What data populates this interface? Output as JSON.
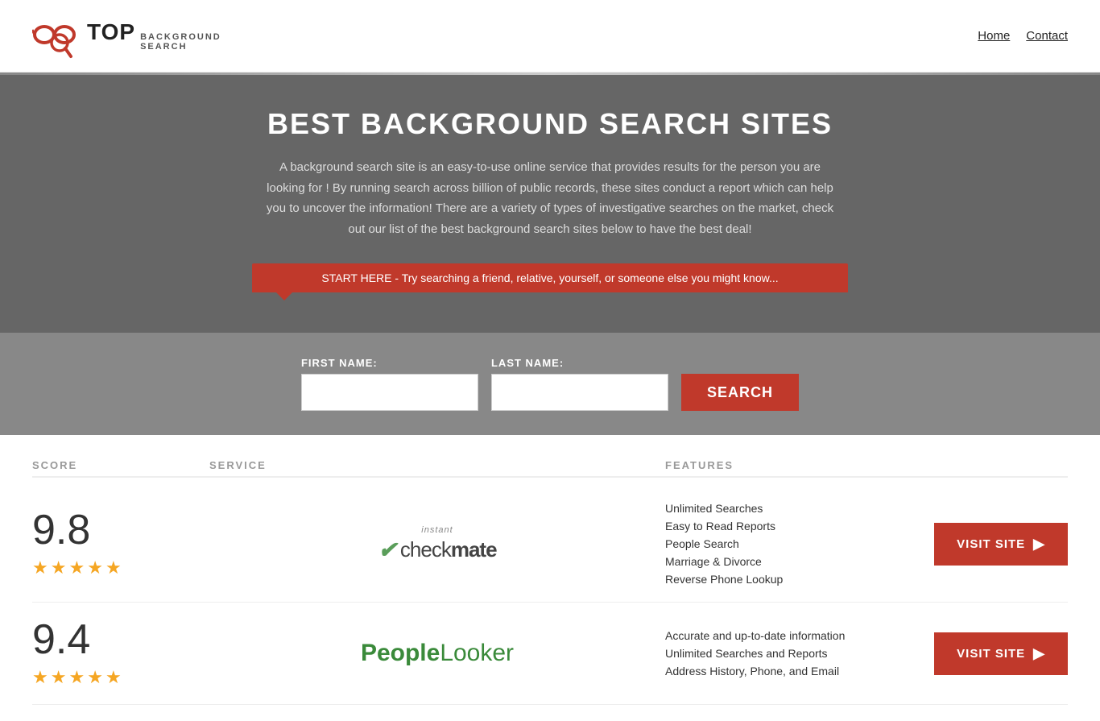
{
  "header": {
    "logo_top": "TOP",
    "logo_sub1": "BACKGROUND",
    "logo_sub2": "SEARCH",
    "nav_home": "Home",
    "nav_contact": "Contact"
  },
  "hero": {
    "title": "BEST BACKGROUND SEARCH SITES",
    "description": "A background search site is an easy-to-use online service that provides results  for the person you are looking for ! By  running  search across billion of public records, these sites conduct  a report which can help you to uncover the information! There are a variety of types of investigative searches on the market, check out our  list of the best background search sites below to have the best deal!",
    "banner_text": "START HERE - Try searching a friend, relative, yourself, or someone else you might know..."
  },
  "search": {
    "first_name_label": "FIRST NAME:",
    "last_name_label": "LAST NAME:",
    "button_label": "SEARCH"
  },
  "table": {
    "headers": {
      "score": "SCORE",
      "service": "SERVICE",
      "features": "FEATURES"
    },
    "rows": [
      {
        "score": "9.8",
        "stars": 4.5,
        "service_name": "Instant Checkmate",
        "features": [
          "Unlimited Searches",
          "Easy to Read Reports",
          "People Search",
          "Marriage & Divorce",
          "Reverse Phone Lookup"
        ],
        "visit_label": "VISIT SITE"
      },
      {
        "score": "9.4",
        "stars": 4.5,
        "service_name": "PeopleLooker",
        "features": [
          "Accurate and up-to-date information",
          "Unlimited Searches and Reports",
          "Address History, Phone, and Email"
        ],
        "visit_label": "VISIT SITE"
      }
    ]
  }
}
